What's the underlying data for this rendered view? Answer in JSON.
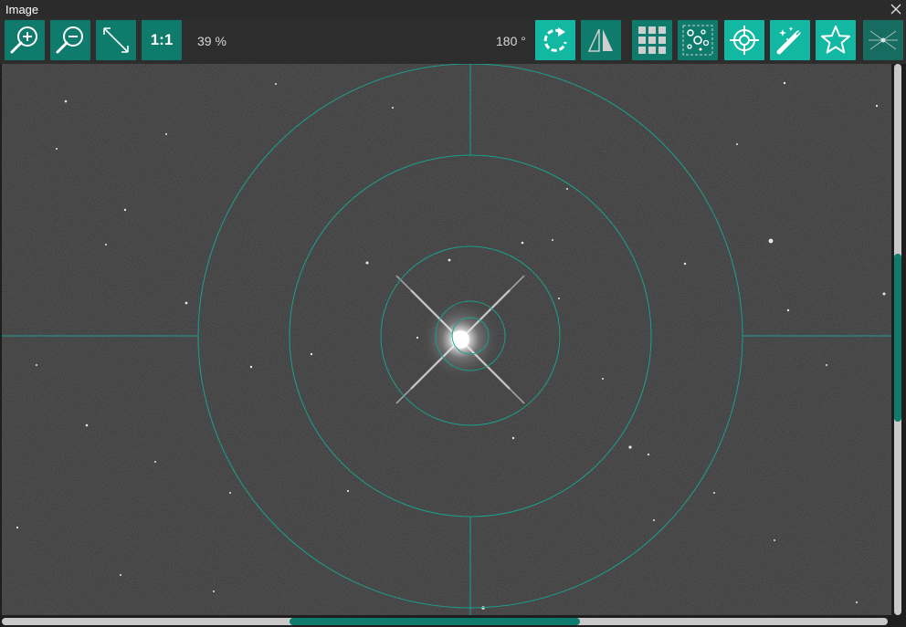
{
  "window": {
    "title": "Image"
  },
  "toolbar": {
    "zoom_in": {
      "icon": "zoom-in-icon"
    },
    "zoom_out": {
      "icon": "zoom-out-icon"
    },
    "fit": {
      "icon": "fit-to-window-icon"
    },
    "one_to_one": {
      "label": "1:1"
    },
    "zoom_level": "39 %",
    "rotation": "180 °",
    "rotate": {
      "icon": "rotate-icon"
    },
    "flip": {
      "icon": "flip-icon"
    },
    "grid": {
      "icon": "grid-icon"
    },
    "stars": {
      "icon": "star-detection-icon"
    },
    "crosshair": {
      "icon": "crosshair-target-icon"
    },
    "magic": {
      "icon": "magic-wand-icon"
    },
    "star": {
      "icon": "star-icon"
    },
    "bahtinov": {
      "icon": "bahtinov-icon"
    }
  },
  "colors": {
    "accent": "#0f7b6c",
    "accent_bright": "#12b8a2",
    "overlay": "#1aa08e",
    "background": "#3a3a3a"
  },
  "scroll": {
    "vertical": 0.39,
    "horizontal": 0.33
  }
}
